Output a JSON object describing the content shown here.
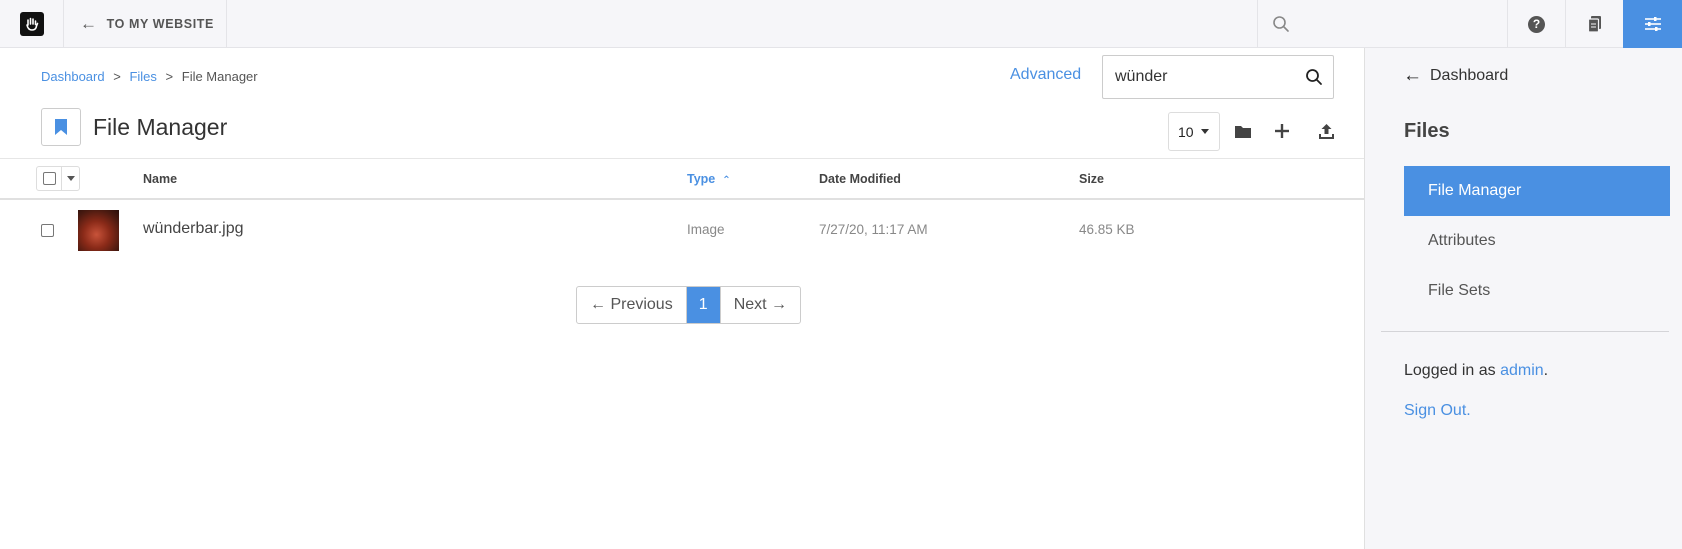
{
  "toolbar": {
    "back_label": "TO MY WEBSITE",
    "icons": [
      "hand-logo-icon",
      "arrow-left-icon",
      "search-icon",
      "help-icon",
      "pages-icon",
      "settings-sliders-icon"
    ]
  },
  "breadcrumb": {
    "items": [
      "Dashboard",
      "Files",
      "File Manager"
    ],
    "separator": ">"
  },
  "search": {
    "advanced_label": "Advanced",
    "value": "wünder"
  },
  "page": {
    "title": "File Manager"
  },
  "actions": {
    "per_page": "10"
  },
  "table": {
    "columns": [
      "Name",
      "Type",
      "Date Modified",
      "Size"
    ],
    "sorted_column": "Type",
    "rows": [
      {
        "name": "wünderbar.jpg",
        "type": "Image",
        "date_modified": "7/27/20, 11:17 AM",
        "size": "46.85 KB"
      }
    ]
  },
  "pagination": {
    "previous": "← Previous",
    "current": "1",
    "next": "Next →"
  },
  "panel": {
    "back_label": "Dashboard",
    "heading": "Files",
    "nav": [
      "File Manager",
      "Attributes",
      "File Sets"
    ],
    "active": "File Manager",
    "logged_in_prefix": "Logged in as ",
    "user": "admin",
    "logged_in_suffix": ".",
    "sign_out": "Sign Out."
  },
  "colors": {
    "accent": "#4a90e2",
    "toolbar_bg": "#f6f6f9",
    "text": "#333333"
  }
}
